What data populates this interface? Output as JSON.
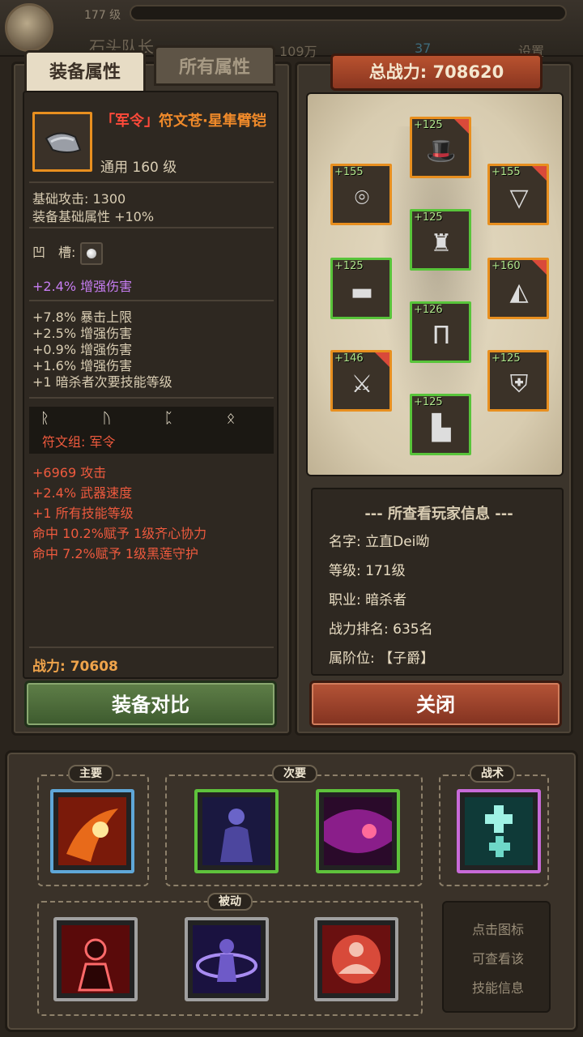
{
  "topbar": {
    "level": "177 级",
    "name": "石头队长",
    "money": "109万",
    "gems": "37",
    "settings": "设置"
  },
  "tabs": {
    "equip": "装备属性",
    "all": "所有属性"
  },
  "item": {
    "title_bracket": "「军令」",
    "title_name": "符文苍·星隼臂铠",
    "class_level": "通用 160 级",
    "base_attack": "基础攻击: 1300",
    "base_attr": "装备基础属性 +10%",
    "socket_label": "凹　槽:",
    "socket_bonus": "+2.4% 增强伤害",
    "stats": [
      "+7.8% 暴击上限",
      "+2.5% 增强伤害",
      "+0.9% 增强伤害",
      "+1.6% 增强伤害",
      "+1 暗杀者次要技能等级"
    ],
    "runes": "ᚱ ᚢ ᛈ ᛟ",
    "rune_set": "符文组: 军令",
    "set_bonuses": [
      "+6969 攻击",
      "+2.4% 武器速度",
      "+1 所有技能等级",
      "命中 10.2%赋予 1级齐心协力",
      "命中 7.2%赋予 1级黑莲守护"
    ],
    "power": "战力: 70608"
  },
  "buttons": {
    "compare": "装备对比",
    "close": "关闭"
  },
  "total_power": "总战力: 708620",
  "slots": [
    {
      "name": "hat",
      "level": "+125",
      "quality": "orange",
      "corner": true,
      "icon": "🎩"
    },
    {
      "name": "bracer",
      "level": "+155",
      "quality": "orange",
      "corner": false,
      "icon": "⌾"
    },
    {
      "name": "necklace",
      "level": "+155",
      "quality": "orange",
      "corner": true,
      "icon": "▽"
    },
    {
      "name": "armor",
      "level": "+125",
      "quality": "green",
      "corner": false,
      "icon": "♜"
    },
    {
      "name": "belt",
      "level": "+125",
      "quality": "green",
      "corner": false,
      "icon": "▬"
    },
    {
      "name": "arm-guard",
      "level": "+160",
      "quality": "orange",
      "corner": true,
      "icon": "◭"
    },
    {
      "name": "pants",
      "level": "+126",
      "quality": "green",
      "corner": false,
      "icon": "Π"
    },
    {
      "name": "weapon",
      "level": "+146",
      "quality": "orange",
      "corner": true,
      "icon": "⚔"
    },
    {
      "name": "shield",
      "level": "+125",
      "quality": "orange",
      "corner": false,
      "icon": "⛨"
    },
    {
      "name": "boots",
      "level": "+125",
      "quality": "green",
      "corner": false,
      "icon": "▙"
    }
  ],
  "player_info": {
    "title": "--- 所查看玩家信息 ---",
    "name": "名字: 立直Dei呦",
    "level": "等级: 171级",
    "class": "职业: 暗杀者",
    "rank": "战力排名: 635名",
    "title_rank": "属阶位: 【子爵】"
  },
  "skills": {
    "primary_label": "主要",
    "secondary_label": "次要",
    "tactic_label": "战术",
    "passive_label": "被动",
    "hint": [
      "点击图标",
      "可查看该",
      "技能信息"
    ]
  },
  "colors": {
    "orange_quality": "#e88f1f",
    "green_quality": "#58c43a",
    "title_orange": "#f08a2a",
    "set_red": "#ef5a3e",
    "socket_purple": "#c77df2"
  }
}
